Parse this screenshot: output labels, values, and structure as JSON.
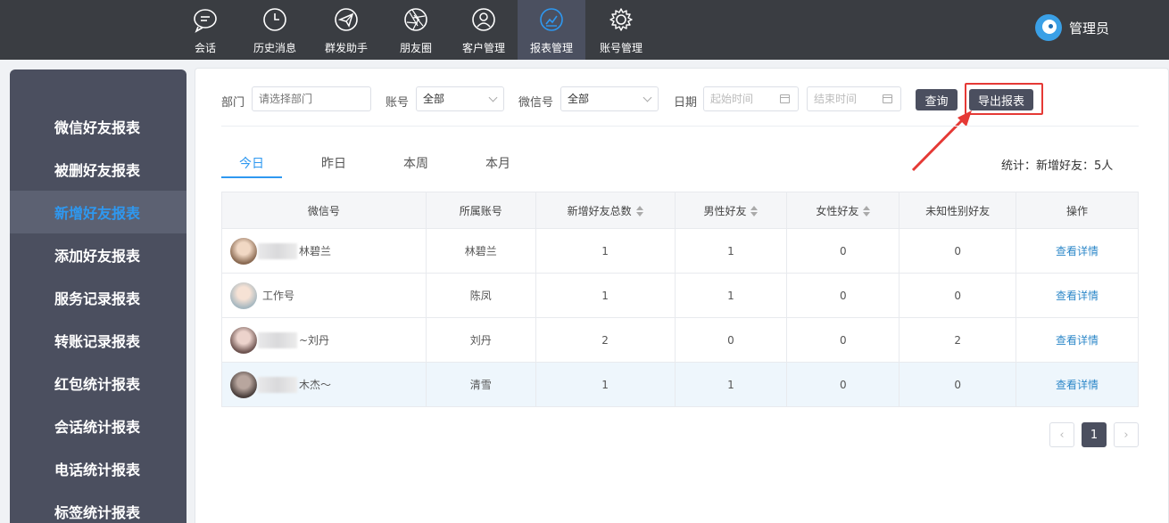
{
  "nav": {
    "items": [
      {
        "label": "会话",
        "icon": "chat-icon"
      },
      {
        "label": "历史消息",
        "icon": "clock-icon"
      },
      {
        "label": "群发助手",
        "icon": "send-icon"
      },
      {
        "label": "朋友圈",
        "icon": "aperture-icon"
      },
      {
        "label": "客户管理",
        "icon": "user-icon"
      },
      {
        "label": "报表管理",
        "icon": "chart-icon"
      },
      {
        "label": "账号管理",
        "icon": "gear-icon"
      }
    ],
    "active": "报表管理",
    "user": "管理员"
  },
  "sidebar": {
    "items": [
      "微信好友报表",
      "被删好友报表",
      "新增好友报表",
      "添加好友报表",
      "服务记录报表",
      "转账记录报表",
      "红包统计报表",
      "会话统计报表",
      "电话统计报表",
      "标签统计报表"
    ],
    "active": "新增好友报表"
  },
  "filters": {
    "dept_label": "部门",
    "dept_placeholder": "请选择部门",
    "account_label": "账号",
    "account_value": "全部",
    "wechat_label": "微信号",
    "wechat_value": "全部",
    "date_label": "日期",
    "start_placeholder": "起始时间",
    "end_placeholder": "结束时间",
    "query_button": "查询",
    "export_button": "导出报表"
  },
  "tabs": [
    "今日",
    "昨日",
    "本周",
    "本月"
  ],
  "active_tab": "今日",
  "stats": "统计：新增好友：5人",
  "table": {
    "headers": [
      "微信号",
      "所属账号",
      "新增好友总数",
      "男性好友",
      "女性好友",
      "未知性别好友",
      "操作"
    ],
    "rows": [
      {
        "wechat": "林碧兰",
        "account": "林碧兰",
        "total": "1",
        "male": "1",
        "female": "0",
        "unknown": "0",
        "action": "查看详情",
        "avatar_color": "#c8a88a"
      },
      {
        "wechat": "工作号",
        "account": "陈凤",
        "total": "1",
        "male": "1",
        "female": "0",
        "unknown": "0",
        "action": "查看详情",
        "avatar_color": "#d9c2b5"
      },
      {
        "wechat": "~刘丹",
        "account": "刘丹",
        "total": "2",
        "male": "0",
        "female": "0",
        "unknown": "2",
        "action": "查看详情",
        "avatar_color": "#a58a86"
      },
      {
        "wechat": "木杰～",
        "account": "清雪",
        "total": "1",
        "male": "1",
        "female": "0",
        "unknown": "0",
        "action": "查看详情",
        "avatar_color": "#6b5d58"
      }
    ]
  },
  "pagination": {
    "prev": "‹",
    "current": "1",
    "next": "›"
  },
  "colors": {
    "accent": "#2e98f0",
    "dark": "#4b4f5f",
    "highlight": "#e53935"
  }
}
